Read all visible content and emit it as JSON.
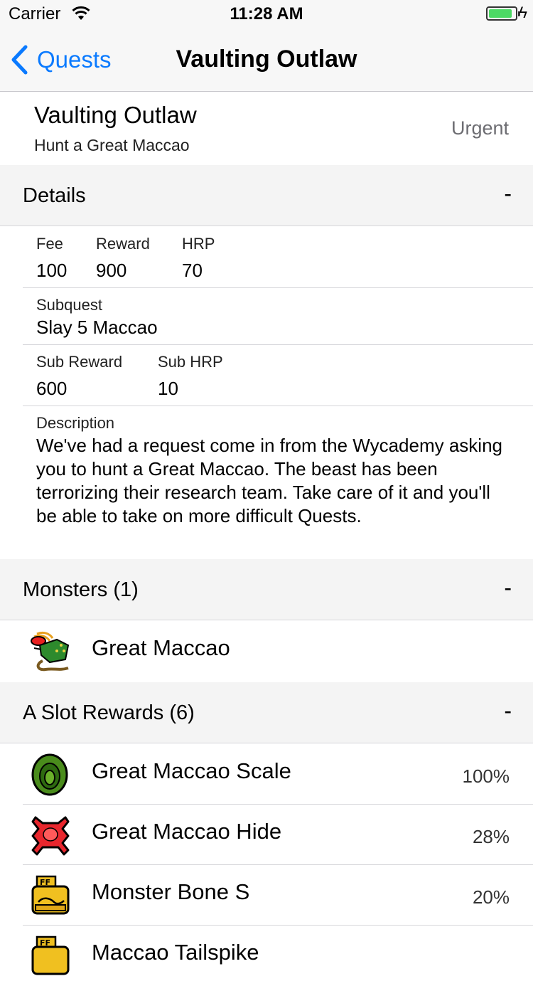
{
  "status": {
    "carrier": "Carrier",
    "time": "11:28 AM",
    "battery_level": 0.9
  },
  "nav": {
    "back_label": "Quests",
    "title": "Vaulting Outlaw"
  },
  "quest": {
    "name": "Vaulting Outlaw",
    "goal": "Hunt a Great Maccao",
    "tag": "Urgent"
  },
  "details": {
    "title": "Details",
    "toggle": "-",
    "fee_label": "Fee",
    "fee": "100",
    "reward_label": "Reward",
    "reward": "900",
    "hrp_label": "HRP",
    "hrp": "70",
    "subquest_label": "Subquest",
    "subquest": "Slay 5 Maccao",
    "sub_reward_label": "Sub Reward",
    "sub_reward": "600",
    "sub_hrp_label": "Sub HRP",
    "sub_hrp": "10",
    "description_label": "Description",
    "description": "We've had a request come in from the Wycademy asking you to hunt a Great Maccao. The beast has been terrorizing their research team. Take care of it and you'll be able to take on more difficult Quests."
  },
  "monsters": {
    "title": "Monsters (1)",
    "toggle": "-",
    "items": [
      {
        "name": "Great Maccao",
        "icon": "great-maccao-icon"
      }
    ]
  },
  "rewards": {
    "title": "A Slot Rewards (6)",
    "toggle": "-",
    "items": [
      {
        "name": "Great Maccao Scale",
        "chance": "100%",
        "icon": "scale-icon",
        "color": "#4a8c1c"
      },
      {
        "name": "Great Maccao Hide",
        "chance": "28%",
        "icon": "hide-icon",
        "color": "#e8262d"
      },
      {
        "name": "Monster Bone S",
        "chance": "20%",
        "icon": "bone-icon",
        "color": "#f0c020"
      },
      {
        "name": "Maccao Tailspike",
        "chance": "",
        "icon": "bone-icon",
        "color": "#f0c020"
      }
    ]
  }
}
